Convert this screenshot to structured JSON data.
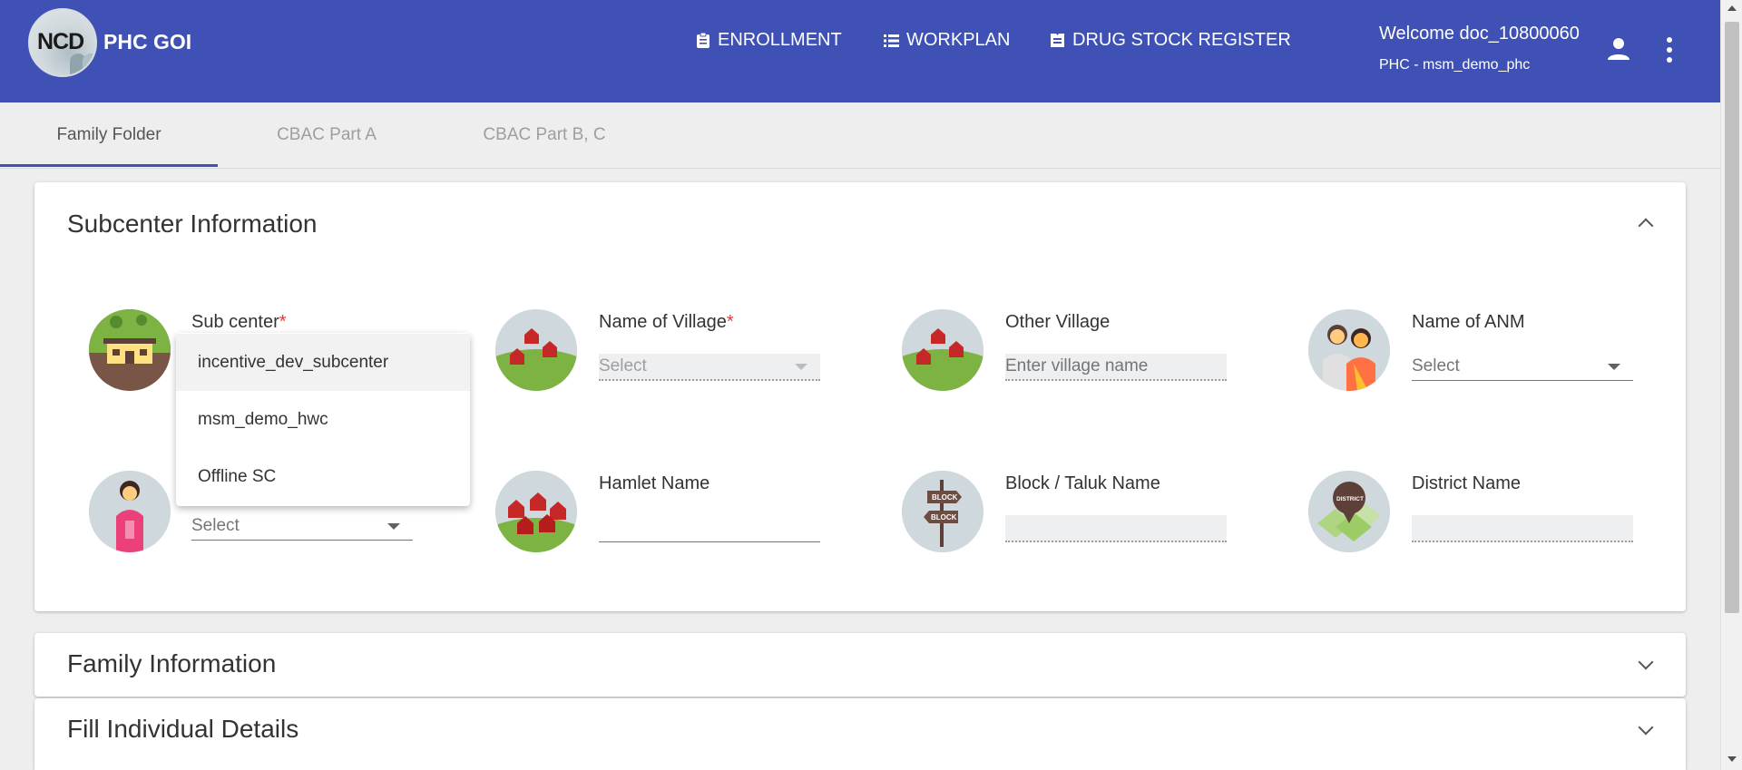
{
  "header": {
    "logo_text": "NCD",
    "app_name": "PHC GOI",
    "nav": [
      {
        "label": "ENROLLMENT",
        "icon": "clipboard-icon"
      },
      {
        "label": "WORKPLAN",
        "icon": "list-icon"
      },
      {
        "label": "DRUG STOCK REGISTER",
        "icon": "register-icon"
      }
    ],
    "welcome": "Welcome doc_10800060",
    "phc": "PHC - msm_demo_phc"
  },
  "tabs": [
    {
      "label": "Family Folder",
      "active": true
    },
    {
      "label": "CBAC Part A",
      "active": false
    },
    {
      "label": "CBAC Part B, C",
      "active": false
    }
  ],
  "subcenter": {
    "title": "Subcenter Information",
    "fields": {
      "subcenter": {
        "label": "Sub center",
        "required": "*",
        "icon": "health-center-icon"
      },
      "village": {
        "label": "Name of Village",
        "required": "*",
        "placeholder": "Select",
        "icon": "village-houses-icon"
      },
      "other_village": {
        "label": "Other Village",
        "placeholder": "Enter village name",
        "icon": "village-houses-icon"
      },
      "anm": {
        "label": "Name of ANM",
        "placeholder": "Select",
        "icon": "anm-nurse-icon"
      },
      "asha": {
        "placeholder": "Select",
        "icon": "asha-worker-icon"
      },
      "hamlet": {
        "label": "Hamlet Name",
        "icon": "hamlet-huts-icon"
      },
      "block": {
        "label": "Block / Taluk Name",
        "icon": "block-signpost-icon",
        "sign_text": "BLOCK"
      },
      "district": {
        "label": "District Name",
        "icon": "district-map-pin-icon",
        "pin_text": "DISTRICT"
      }
    },
    "dropdown_options": [
      "incentive_dev_subcenter",
      "msm_demo_hwc",
      "Offline SC"
    ]
  },
  "family": {
    "title": "Family Information"
  },
  "individual": {
    "title": "Fill Individual Details"
  },
  "colors": {
    "primary": "#3f51b5",
    "required": "#e53935"
  }
}
